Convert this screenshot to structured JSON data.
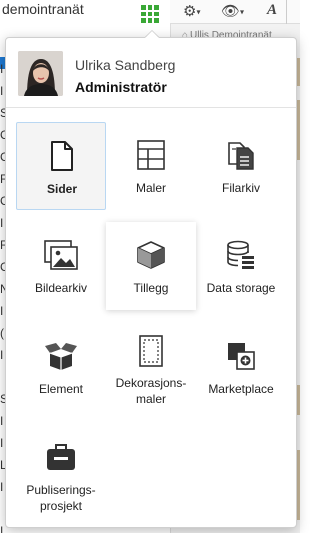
{
  "background": {
    "page_title": "demointranät",
    "breadcrumb": "Ullis Demointranät",
    "side_letters": [
      "I",
      "I",
      "S",
      "C",
      "C",
      "F",
      "C",
      "I",
      "F",
      "C",
      "N",
      "I",
      "(",
      "I",
      "",
      "S",
      "I",
      "I",
      "L",
      "I",
      "",
      "I"
    ],
    "toolbar": {
      "settings_icon": "gear-icon",
      "view_icon": "eye-icon",
      "text_icon": "A"
    },
    "apps_icon": "grid-icon",
    "accent_green": "#3aa836",
    "accent_blue": "#1e7ad4"
  },
  "user": {
    "name": "Ulrika Sandberg",
    "role": "Administratör"
  },
  "menu": {
    "items": [
      {
        "label": "Sider",
        "icon": "page-icon",
        "selected": true
      },
      {
        "label": "Maler",
        "icon": "template-icon"
      },
      {
        "label": "Filarkiv",
        "icon": "file-archive-icon"
      },
      {
        "label": "Bildearkiv",
        "icon": "image-archive-icon"
      },
      {
        "label": "Tillegg",
        "icon": "cube-icon",
        "hovered": true
      },
      {
        "label": "Data storage",
        "icon": "database-icon"
      },
      {
        "label": "Element",
        "icon": "open-box-icon"
      },
      {
        "label": "Dekorasjons-\nmaler",
        "icon": "decoration-template-icon"
      },
      {
        "label": "Marketplace",
        "icon": "marketplace-icon"
      },
      {
        "label": "Publiserings-\nprosjekt",
        "icon": "briefcase-icon"
      }
    ]
  }
}
